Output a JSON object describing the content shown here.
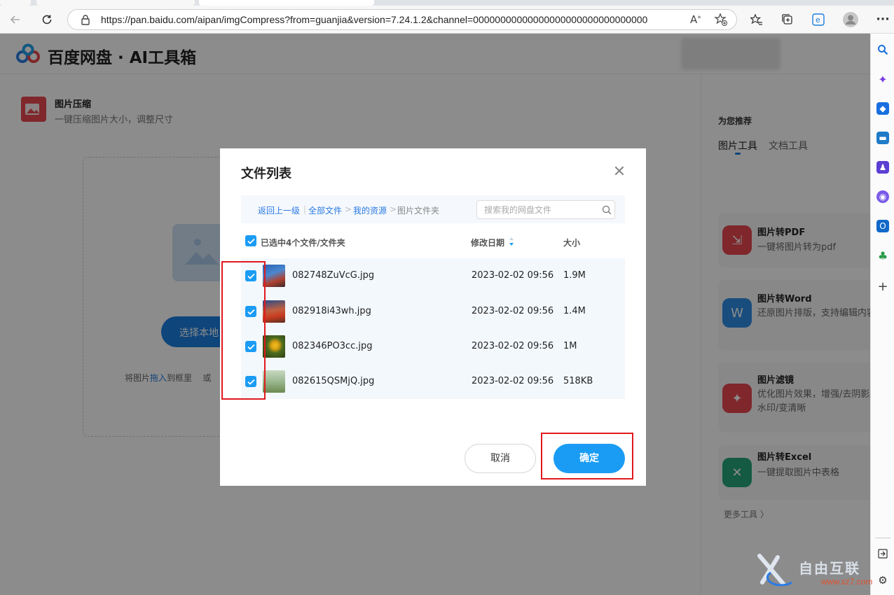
{
  "browser": {
    "url": "https://pan.baidu.com/aipan/imgCompress?from=guanjia&version=7.24.1.2&channel=00000000000000000000000000000000"
  },
  "header": {
    "logo_text": "百度网盘 · AI工具箱"
  },
  "tool": {
    "title": "图片压缩",
    "desc": "一键压缩图片大小，调整尺寸"
  },
  "upload": {
    "button_label": "选择本地",
    "hint_prefix": "将图片",
    "hint_link": "拖入",
    "hint_mid": "到框里",
    "hint_or": "或"
  },
  "recommend": {
    "title": "为您推荐",
    "tabs": [
      {
        "label": "图片工具"
      },
      {
        "label": "文档工具"
      }
    ],
    "cards": [
      {
        "title": "图片转PDF",
        "desc": "一键将图片转为pdf",
        "color": "#e8484f"
      },
      {
        "title": "图片转Word",
        "desc": "还原图片排版，支持编辑内容",
        "color": "#2f8de4"
      },
      {
        "title": "图片滤镜",
        "desc": "优化图片效果，增强/去阴影/去水印/变清晰",
        "color": "#e8484f"
      },
      {
        "title": "图片转Excel",
        "desc": "一键提取图片中表格",
        "color": "#27a57a"
      }
    ],
    "more": "更多工具 〉"
  },
  "modal": {
    "title": "文件列表",
    "breadcrumb": {
      "back": "返回上一级",
      "all": "全部文件",
      "resources": "我的资源",
      "current": "图片文件夹",
      "sep": ">"
    },
    "search": {
      "placeholder": "搜索我的网盘文件",
      "value": ""
    },
    "columns": {
      "selected": "已选中4个文件/文件夹",
      "date": "修改日期",
      "size": "大小"
    },
    "files": [
      {
        "name": "082748ZuVcG.jpg",
        "date": "2023-02-02 09:56",
        "size": "1.9M",
        "checked": true
      },
      {
        "name": "082918i43wh.jpg",
        "date": "2023-02-02 09:56",
        "size": "1.4M",
        "checked": true
      },
      {
        "name": "082346PO3cc.jpg",
        "date": "2023-02-02 09:56",
        "size": "1M",
        "checked": true
      },
      {
        "name": "082615QSMjQ.jpg",
        "date": "2023-02-02 09:56",
        "size": "518KB",
        "checked": true
      }
    ],
    "cancel": "取消",
    "confirm": "确定"
  },
  "colors": {
    "accent": "#1a9cf4",
    "highlight": "#e0191d",
    "link": "#2a7be4"
  },
  "watermark": {
    "text": "自由互联",
    "site": "www.xz7.com"
  }
}
